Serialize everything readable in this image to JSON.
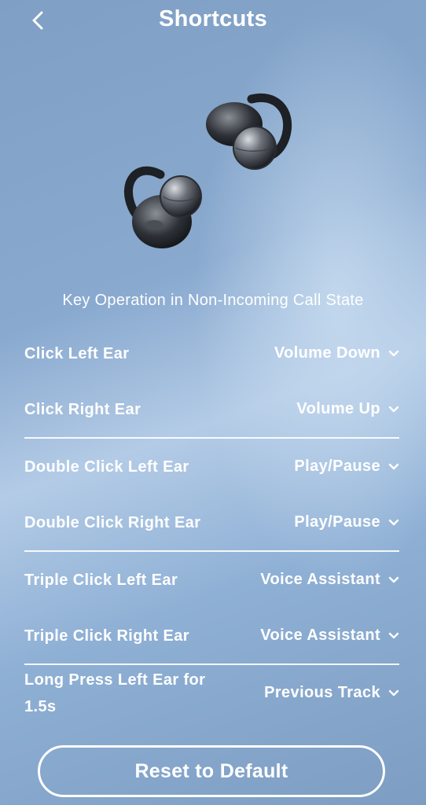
{
  "header": {
    "title": "Shortcuts"
  },
  "subtitle": "Key Operation in Non-Incoming Call State",
  "rows": [
    {
      "label": "Click Left Ear",
      "value": "Volume Down"
    },
    {
      "label": "Click Right Ear",
      "value": "Volume Up"
    },
    {
      "label": "Double Click Left Ear",
      "value": "Play/Pause"
    },
    {
      "label": "Double Click Right Ear",
      "value": "Play/Pause"
    },
    {
      "label": "Triple Click Left Ear",
      "value": "Voice Assistant"
    },
    {
      "label": "Triple Click Right Ear",
      "value": "Voice Assistant"
    },
    {
      "label": "Long Press Left Ear for 1.5s",
      "value": "Previous Track"
    }
  ],
  "reset_label": "Reset to Default",
  "icons": {
    "back": "chevron-left-icon",
    "dropdown": "chevron-down-icon",
    "product": "earbuds-image"
  }
}
